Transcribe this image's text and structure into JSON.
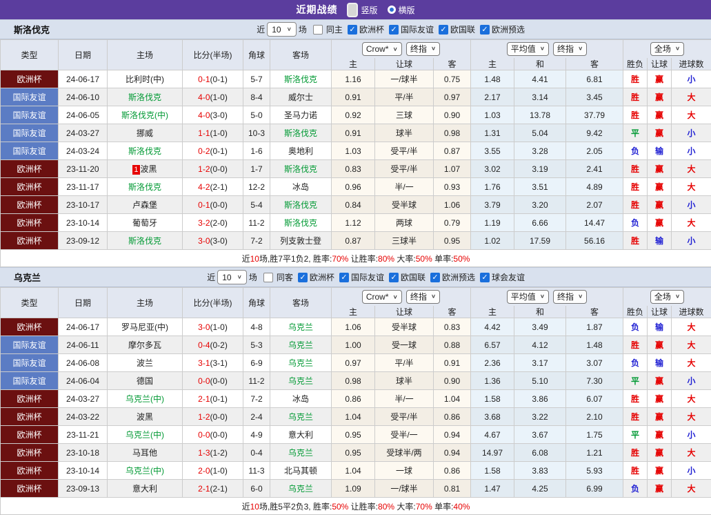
{
  "header": {
    "title": "近期战绩",
    "vertical_label": "竖版",
    "horizontal_label": "横版"
  },
  "table_header": {
    "static_cols": [
      "类型",
      "日期",
      "主场",
      "比分(半场)",
      "角球",
      "客场"
    ],
    "odds_dropdown": "Crow*",
    "final_dropdown1": "终指",
    "avg_dropdown": "平均值",
    "final_dropdown2": "终指",
    "fullgame_dropdown": "全场",
    "odds_cols": [
      "主",
      "让球",
      "客"
    ],
    "avg_cols": [
      "主",
      "和",
      "客"
    ],
    "result_cols": [
      "胜负",
      "让球",
      "进球数"
    ]
  },
  "filter_labels": {
    "near": "近",
    "count": "10",
    "games": "场"
  },
  "sections": [
    {
      "team": "斯洛伐克",
      "same_filter": {
        "label": "同主",
        "checked": false
      },
      "leagues": [
        {
          "label": "欧洲杯",
          "checked": true
        },
        {
          "label": "国际友谊",
          "checked": true
        },
        {
          "label": "欧国联",
          "checked": true
        },
        {
          "label": "欧洲预选",
          "checked": true
        }
      ],
      "rows": [
        {
          "type": "欧洲杯",
          "type_class": "euro",
          "date": "24-06-17",
          "home": "比利时(中)",
          "home_green": false,
          "home_badge": "",
          "score": "0-1",
          "half": "(0-1)",
          "corner": "5-7",
          "away": "斯洛伐克",
          "away_green": true,
          "o1": "1.16",
          "o2": "一/球半",
          "o3": "0.75",
          "a1": "1.48",
          "a2": "4.41",
          "a3": "6.81",
          "r1": "胜",
          "r1c": "red",
          "r2": "赢",
          "r2c": "red",
          "r3": "小",
          "r3c": "blue"
        },
        {
          "type": "国际友谊",
          "type_class": "friendly",
          "date": "24-06-10",
          "home": "斯洛伐克",
          "home_green": true,
          "home_badge": "",
          "score": "4-0",
          "half": "(1-0)",
          "corner": "8-4",
          "away": "威尔士",
          "away_green": false,
          "o1": "0.91",
          "o2": "平/半",
          "o3": "0.97",
          "a1": "2.17",
          "a2": "3.14",
          "a3": "3.45",
          "r1": "胜",
          "r1c": "red",
          "r2": "赢",
          "r2c": "red",
          "r3": "大",
          "r3c": "red"
        },
        {
          "type": "国际友谊",
          "type_class": "friendly",
          "date": "24-06-05",
          "home": "斯洛伐克(中)",
          "home_green": true,
          "home_badge": "",
          "score": "4-0",
          "half": "(3-0)",
          "corner": "5-0",
          "away": "圣马力诺",
          "away_green": false,
          "o1": "0.92",
          "o2": "三球",
          "o3": "0.90",
          "a1": "1.03",
          "a2": "13.78",
          "a3": "37.79",
          "r1": "胜",
          "r1c": "red",
          "r2": "赢",
          "r2c": "red",
          "r3": "大",
          "r3c": "red"
        },
        {
          "type": "国际友谊",
          "type_class": "friendly",
          "date": "24-03-27",
          "home": "挪威",
          "home_green": false,
          "home_badge": "",
          "score": "1-1",
          "half": "(1-0)",
          "corner": "10-3",
          "away": "斯洛伐克",
          "away_green": true,
          "o1": "0.91",
          "o2": "球半",
          "o3": "0.98",
          "a1": "1.31",
          "a2": "5.04",
          "a3": "9.42",
          "r1": "平",
          "r1c": "green",
          "r2": "赢",
          "r2c": "red",
          "r3": "小",
          "r3c": "blue"
        },
        {
          "type": "国际友谊",
          "type_class": "friendly",
          "date": "24-03-24",
          "home": "斯洛伐克",
          "home_green": true,
          "home_badge": "",
          "score": "0-2",
          "half": "(0-1)",
          "corner": "1-6",
          "away": "奥地利",
          "away_green": false,
          "o1": "1.03",
          "o2": "受平/半",
          "o3": "0.87",
          "a1": "3.55",
          "a2": "3.28",
          "a3": "2.05",
          "r1": "负",
          "r1c": "blue",
          "r2": "输",
          "r2c": "blue",
          "r3": "小",
          "r3c": "blue"
        },
        {
          "type": "欧洲杯",
          "type_class": "euro",
          "date": "23-11-20",
          "home": "波黑",
          "home_green": false,
          "home_badge": "1",
          "score": "1-2",
          "half": "(0-0)",
          "corner": "1-7",
          "away": "斯洛伐克",
          "away_green": true,
          "o1": "0.83",
          "o2": "受平/半",
          "o3": "1.07",
          "a1": "3.02",
          "a2": "3.19",
          "a3": "2.41",
          "r1": "胜",
          "r1c": "red",
          "r2": "赢",
          "r2c": "red",
          "r3": "大",
          "r3c": "red"
        },
        {
          "type": "欧洲杯",
          "type_class": "euro",
          "date": "23-11-17",
          "home": "斯洛伐克",
          "home_green": true,
          "home_badge": "",
          "score": "4-2",
          "half": "(2-1)",
          "corner": "12-2",
          "away": "冰岛",
          "away_green": false,
          "o1": "0.96",
          "o2": "半/一",
          "o3": "0.93",
          "a1": "1.76",
          "a2": "3.51",
          "a3": "4.89",
          "r1": "胜",
          "r1c": "red",
          "r2": "赢",
          "r2c": "red",
          "r3": "大",
          "r3c": "red"
        },
        {
          "type": "欧洲杯",
          "type_class": "euro",
          "date": "23-10-17",
          "home": "卢森堡",
          "home_green": false,
          "home_badge": "",
          "score": "0-1",
          "half": "(0-0)",
          "corner": "5-4",
          "away": "斯洛伐克",
          "away_green": true,
          "o1": "0.84",
          "o2": "受半球",
          "o3": "1.06",
          "a1": "3.79",
          "a2": "3.20",
          "a3": "2.07",
          "r1": "胜",
          "r1c": "red",
          "r2": "赢",
          "r2c": "red",
          "r3": "小",
          "r3c": "blue"
        },
        {
          "type": "欧洲杯",
          "type_class": "euro",
          "date": "23-10-14",
          "home": "葡萄牙",
          "home_green": false,
          "home_badge": "",
          "score": "3-2",
          "half": "(2-0)",
          "corner": "11-2",
          "away": "斯洛伐克",
          "away_green": true,
          "o1": "1.12",
          "o2": "两球",
          "o3": "0.79",
          "a1": "1.19",
          "a2": "6.66",
          "a3": "14.47",
          "r1": "负",
          "r1c": "blue",
          "r2": "赢",
          "r2c": "red",
          "r3": "大",
          "r3c": "red"
        },
        {
          "type": "欧洲杯",
          "type_class": "euro",
          "date": "23-09-12",
          "home": "斯洛伐克",
          "home_green": true,
          "home_badge": "",
          "score": "3-0",
          "half": "(3-0)",
          "corner": "7-2",
          "away": "列支敦士登",
          "away_green": false,
          "o1": "0.87",
          "o2": "三球半",
          "o3": "0.95",
          "a1": "1.02",
          "a2": "17.59",
          "a3": "56.16",
          "r1": "胜",
          "r1c": "red",
          "r2": "输",
          "r2c": "blue",
          "r3": "小",
          "r3c": "blue"
        }
      ],
      "summary": [
        {
          "t": "近",
          "c": "dark"
        },
        {
          "t": "10",
          "c": "red"
        },
        {
          "t": "场,胜7平1负2, 胜率:",
          "c": "dark"
        },
        {
          "t": "70%",
          "c": "red"
        },
        {
          "t": " 让胜率:",
          "c": "dark"
        },
        {
          "t": "80%",
          "c": "red"
        },
        {
          "t": " 大率:",
          "c": "dark"
        },
        {
          "t": "50%",
          "c": "red"
        },
        {
          "t": " 单率:",
          "c": "dark"
        },
        {
          "t": "50%",
          "c": "red"
        }
      ]
    },
    {
      "team": "乌克兰",
      "same_filter": {
        "label": "同客",
        "checked": false
      },
      "leagues": [
        {
          "label": "欧洲杯",
          "checked": true
        },
        {
          "label": "国际友谊",
          "checked": true
        },
        {
          "label": "欧国联",
          "checked": true
        },
        {
          "label": "欧洲预选",
          "checked": true
        },
        {
          "label": "球会友谊",
          "checked": true
        }
      ],
      "rows": [
        {
          "type": "欧洲杯",
          "type_class": "euro",
          "date": "24-06-17",
          "home": "罗马尼亚(中)",
          "home_green": false,
          "home_badge": "",
          "score": "3-0",
          "half": "(1-0)",
          "corner": "4-8",
          "away": "乌克兰",
          "away_green": true,
          "o1": "1.06",
          "o2": "受半球",
          "o3": "0.83",
          "a1": "4.42",
          "a2": "3.49",
          "a3": "1.87",
          "r1": "负",
          "r1c": "blue",
          "r2": "输",
          "r2c": "blue",
          "r3": "大",
          "r3c": "red"
        },
        {
          "type": "国际友谊",
          "type_class": "friendly",
          "date": "24-06-11",
          "home": "摩尔多瓦",
          "home_green": false,
          "home_badge": "",
          "score": "0-4",
          "half": "(0-2)",
          "corner": "5-3",
          "away": "乌克兰",
          "away_green": true,
          "o1": "1.00",
          "o2": "受一球",
          "o3": "0.88",
          "a1": "6.57",
          "a2": "4.12",
          "a3": "1.48",
          "r1": "胜",
          "r1c": "red",
          "r2": "赢",
          "r2c": "red",
          "r3": "大",
          "r3c": "red"
        },
        {
          "type": "国际友谊",
          "type_class": "friendly",
          "date": "24-06-08",
          "home": "波兰",
          "home_green": false,
          "home_badge": "",
          "score": "3-1",
          "half": "(3-1)",
          "corner": "6-9",
          "away": "乌克兰",
          "away_green": true,
          "o1": "0.97",
          "o2": "平/半",
          "o3": "0.91",
          "a1": "2.36",
          "a2": "3.17",
          "a3": "3.07",
          "r1": "负",
          "r1c": "blue",
          "r2": "输",
          "r2c": "blue",
          "r3": "大",
          "r3c": "red"
        },
        {
          "type": "国际友谊",
          "type_class": "friendly",
          "date": "24-06-04",
          "home": "德国",
          "home_green": false,
          "home_badge": "",
          "score": "0-0",
          "half": "(0-0)",
          "corner": "11-2",
          "away": "乌克兰",
          "away_green": true,
          "o1": "0.98",
          "o2": "球半",
          "o3": "0.90",
          "a1": "1.36",
          "a2": "5.10",
          "a3": "7.30",
          "r1": "平",
          "r1c": "green",
          "r2": "赢",
          "r2c": "red",
          "r3": "小",
          "r3c": "blue"
        },
        {
          "type": "欧洲杯",
          "type_class": "euro",
          "date": "24-03-27",
          "home": "乌克兰(中)",
          "home_green": true,
          "home_badge": "",
          "score": "2-1",
          "half": "(0-1)",
          "corner": "7-2",
          "away": "冰岛",
          "away_green": false,
          "o1": "0.86",
          "o2": "半/一",
          "o3": "1.04",
          "a1": "1.58",
          "a2": "3.86",
          "a3": "6.07",
          "r1": "胜",
          "r1c": "red",
          "r2": "赢",
          "r2c": "red",
          "r3": "大",
          "r3c": "red"
        },
        {
          "type": "欧洲杯",
          "type_class": "euro",
          "date": "24-03-22",
          "home": "波黑",
          "home_green": false,
          "home_badge": "",
          "score": "1-2",
          "half": "(0-0)",
          "corner": "2-4",
          "away": "乌克兰",
          "away_green": true,
          "o1": "1.04",
          "o2": "受平/半",
          "o3": "0.86",
          "a1": "3.68",
          "a2": "3.22",
          "a3": "2.10",
          "r1": "胜",
          "r1c": "red",
          "r2": "赢",
          "r2c": "red",
          "r3": "大",
          "r3c": "red"
        },
        {
          "type": "欧洲杯",
          "type_class": "euro",
          "date": "23-11-21",
          "home": "乌克兰(中)",
          "home_green": true,
          "home_badge": "",
          "score": "0-0",
          "half": "(0-0)",
          "corner": "4-9",
          "away": "意大利",
          "away_green": false,
          "o1": "0.95",
          "o2": "受半/一",
          "o3": "0.94",
          "a1": "4.67",
          "a2": "3.67",
          "a3": "1.75",
          "r1": "平",
          "r1c": "green",
          "r2": "赢",
          "r2c": "red",
          "r3": "小",
          "r3c": "blue"
        },
        {
          "type": "欧洲杯",
          "type_class": "euro",
          "date": "23-10-18",
          "home": "马耳他",
          "home_green": false,
          "home_badge": "",
          "score": "1-3",
          "half": "(1-2)",
          "corner": "0-4",
          "away": "乌克兰",
          "away_green": true,
          "o1": "0.95",
          "o2": "受球半/两",
          "o3": "0.94",
          "a1": "14.97",
          "a2": "6.08",
          "a3": "1.21",
          "r1": "胜",
          "r1c": "red",
          "r2": "赢",
          "r2c": "red",
          "r3": "大",
          "r3c": "red"
        },
        {
          "type": "欧洲杯",
          "type_class": "euro",
          "date": "23-10-14",
          "home": "乌克兰(中)",
          "home_green": true,
          "home_badge": "",
          "score": "2-0",
          "half": "(1-0)",
          "corner": "11-3",
          "away": "北马其顿",
          "away_green": false,
          "o1": "1.04",
          "o2": "一球",
          "o3": "0.86",
          "a1": "1.58",
          "a2": "3.83",
          "a3": "5.93",
          "r1": "胜",
          "r1c": "red",
          "r2": "赢",
          "r2c": "red",
          "r3": "小",
          "r3c": "blue"
        },
        {
          "type": "欧洲杯",
          "type_class": "euro",
          "date": "23-09-13",
          "home": "意大利",
          "home_green": false,
          "home_badge": "",
          "score": "2-1",
          "half": "(2-1)",
          "corner": "6-0",
          "away": "乌克兰",
          "away_green": true,
          "o1": "1.09",
          "o2": "一/球半",
          "o3": "0.81",
          "a1": "1.47",
          "a2": "4.25",
          "a3": "6.99",
          "r1": "负",
          "r1c": "blue",
          "r2": "赢",
          "r2c": "red",
          "r3": "大",
          "r3c": "red"
        }
      ],
      "summary": [
        {
          "t": "近",
          "c": "dark"
        },
        {
          "t": "10",
          "c": "red"
        },
        {
          "t": "场,胜5平2负3, 胜率:",
          "c": "dark"
        },
        {
          "t": "50%",
          "c": "red"
        },
        {
          "t": " 让胜率:",
          "c": "dark"
        },
        {
          "t": "80%",
          "c": "red"
        },
        {
          "t": " 大率:",
          "c": "dark"
        },
        {
          "t": "70%",
          "c": "red"
        },
        {
          "t": " 单率:",
          "c": "dark"
        },
        {
          "t": "40%",
          "c": "red"
        }
      ]
    }
  ],
  "colors": {
    "titlebar": "#5b3d9e",
    "euro_badge": "#6b1010",
    "friendly_badge": "#5b7cc4",
    "team_green": "#009933",
    "score_red": "#e60000",
    "result_blue": "#1f1fd3",
    "checkbox_blue": "#1a6fdc"
  }
}
